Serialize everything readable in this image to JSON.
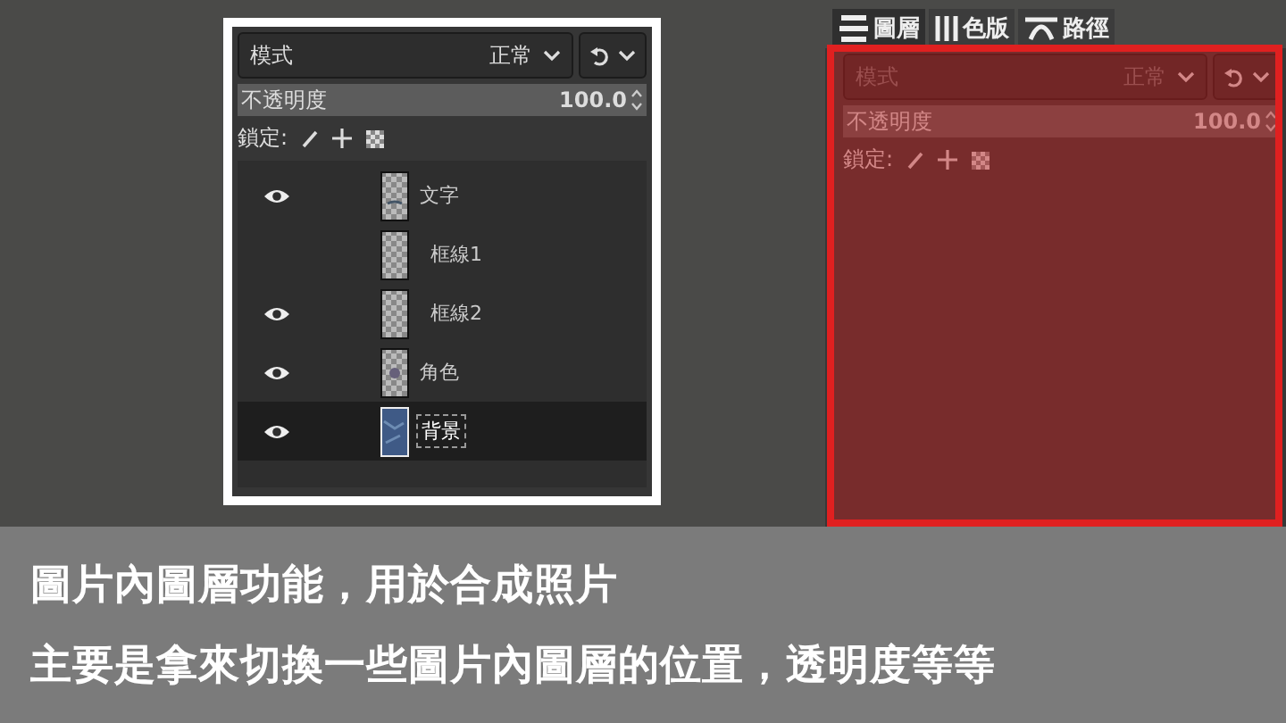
{
  "inset": {
    "mode": {
      "label": "模式",
      "value": "正常"
    },
    "opacity": {
      "label": "不透明度",
      "value": "100.0",
      "level": 1
    },
    "lock": {
      "label": "鎖定:"
    },
    "layers": [
      {
        "name": "文字",
        "visible": true,
        "selected": false,
        "kind": "text"
      },
      {
        "name": "框線1",
        "visible": false,
        "selected": false,
        "kind": "empty"
      },
      {
        "name": "框線2",
        "visible": true,
        "selected": false,
        "kind": "empty"
      },
      {
        "name": "角色",
        "visible": true,
        "selected": false,
        "kind": "figure"
      },
      {
        "name": "背景",
        "visible": true,
        "selected": true,
        "kind": "photo"
      }
    ]
  },
  "dock": {
    "highlighted": true,
    "tabs": [
      {
        "label": "圖層",
        "selected": true,
        "kind": "layers"
      },
      {
        "label": "色版",
        "selected": false,
        "kind": "channels"
      },
      {
        "label": "路徑",
        "selected": false,
        "kind": "paths"
      }
    ],
    "mode": {
      "label": "模式",
      "value": "正常"
    },
    "opacity": {
      "label": "不透明度",
      "value": "100.0",
      "level": 1
    },
    "lock": {
      "label": "鎖定:"
    }
  },
  "caption": [
    "圖片內圖層功能，用於合成照片",
    "主要是拿來切換一些圖片內圖層的位置，透明度等等"
  ]
}
